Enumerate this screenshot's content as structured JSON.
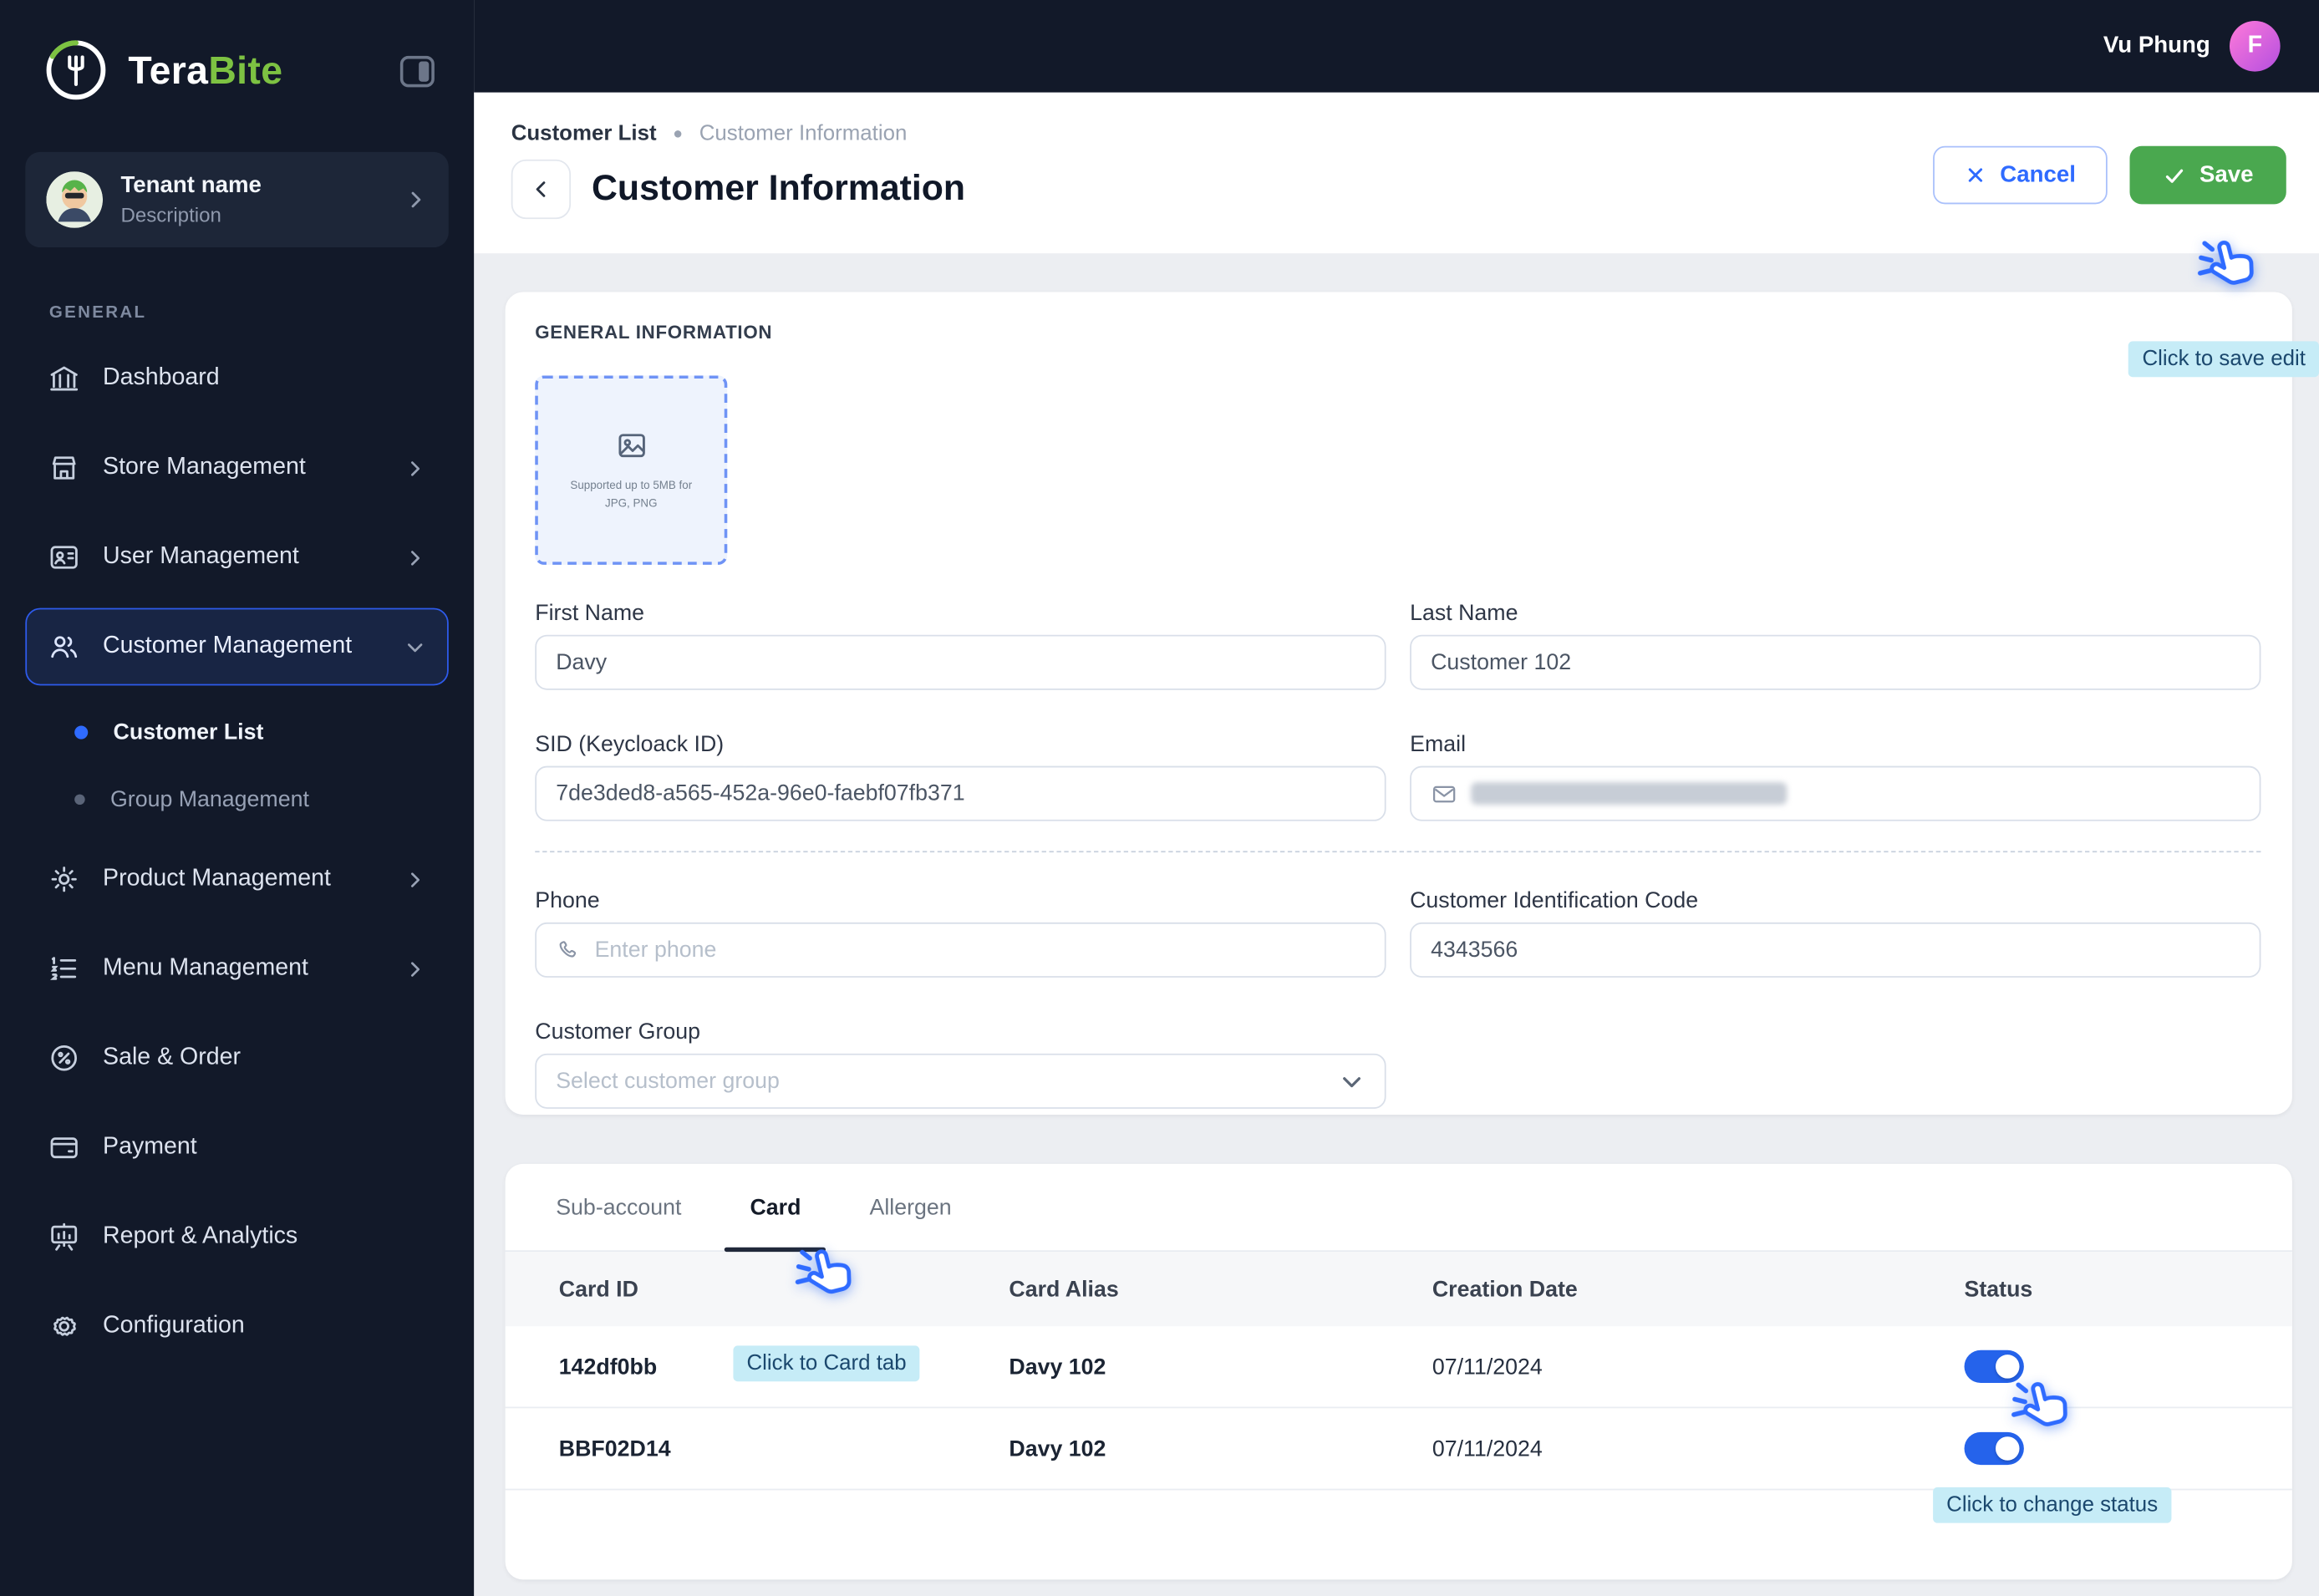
{
  "topbar": {
    "user_name": "Vu Phung",
    "avatar_initial": "F"
  },
  "sidebar": {
    "brand": {
      "part1": "Tera",
      "part2": "Bite"
    },
    "tenant": {
      "name": "Tenant name",
      "description": "Description"
    },
    "section_label": "GENERAL",
    "items": [
      {
        "label": "Dashboard"
      },
      {
        "label": "Store Management"
      },
      {
        "label": "User Management"
      },
      {
        "label": "Customer Management"
      },
      {
        "label": "Product Management"
      },
      {
        "label": "Menu Management"
      },
      {
        "label": "Sale & Order"
      },
      {
        "label": "Payment"
      },
      {
        "label": "Report & Analytics"
      },
      {
        "label": "Configuration"
      }
    ],
    "customer_submenu": [
      {
        "label": "Customer List"
      },
      {
        "label": "Group Management"
      }
    ]
  },
  "header": {
    "breadcrumb": {
      "parent": "Customer List",
      "current": "Customer Information"
    },
    "title": "Customer Information",
    "actions": {
      "cancel": "Cancel",
      "save": "Save"
    }
  },
  "general_info": {
    "section_title": "GENERAL INFORMATION",
    "upload_hint_line1": "Supported up to 5MB for",
    "upload_hint_line2": "JPG, PNG",
    "first_name": {
      "label": "First Name",
      "value": "Davy"
    },
    "last_name": {
      "label": "Last Name",
      "value": "Customer 102"
    },
    "sid": {
      "label": "SID (Keycloack ID)",
      "value": "7de3ded8-a565-452a-96e0-faebf07fb371"
    },
    "email": {
      "label": "Email",
      "value": "",
      "redacted": true
    },
    "phone": {
      "label": "Phone",
      "placeholder": "Enter phone"
    },
    "identification_code": {
      "label": "Customer Identification Code",
      "value": "4343566"
    },
    "customer_group": {
      "label": "Customer Group",
      "placeholder": "Select customer group"
    }
  },
  "tabs": {
    "items": [
      {
        "label": "Sub-account"
      },
      {
        "label": "Card"
      },
      {
        "label": "Allergen"
      }
    ],
    "active": "Card"
  },
  "card_table": {
    "columns": {
      "id": "Card ID",
      "alias": "Card Alias",
      "date": "Creation Date",
      "status": "Status"
    },
    "rows": [
      {
        "id": "142df0bb",
        "alias": "Davy 102",
        "date": "07/11/2024",
        "status_on": true
      },
      {
        "id": "BBF02D14",
        "alias": "Davy 102",
        "date": "07/11/2024",
        "status_on": true
      }
    ]
  },
  "annotations": {
    "save": "Click to save edit",
    "card_tab": "Click to Card tab",
    "status": "Click to change status"
  },
  "colors": {
    "sidebar_bg": "#121929",
    "accent_blue": "#2F6BFF",
    "active_border": "#2E5BEC",
    "save_green": "#4AA84F",
    "toggle_on": "#2563EB",
    "tooltip_bg": "#C6ECF7",
    "brand_green": "#7DC242",
    "avatar_pink": "#E35EC7",
    "page_bg": "#ECEEF2"
  }
}
